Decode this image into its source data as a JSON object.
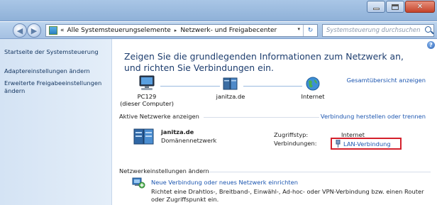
{
  "window": {
    "buttons": {
      "minimize": "",
      "maximize": "",
      "close": "✕"
    },
    "colors": {
      "titlebar": "#a9c6e6",
      "link": "#1c56b0",
      "highlight_box": "#d4202c"
    }
  },
  "address_bar": {
    "prefix": "«",
    "crumbs": [
      "Alle Systemsteuerungselemente",
      "Netzwerk- und Freigabecenter"
    ],
    "separator": "▸",
    "dropdown": "▾",
    "refresh": "↻",
    "search_placeholder": "Systemsteuerung durchsuchen"
  },
  "nav": {
    "back": "◀",
    "forward": "▶"
  },
  "sidebar": {
    "items": [
      {
        "label": "Startseite der Systemsteuerung"
      },
      {
        "label": "Adaptereinstellungen ändern"
      },
      {
        "label": "Erweiterte Freigabeeinstellungen ändern"
      }
    ]
  },
  "main": {
    "help": "?",
    "headline": "Zeigen Sie die grundlegenden Informationen zum Netzwerk an, und richten Sie Verbindungen ein.",
    "overview_link": "Gesamtübersicht anzeigen",
    "map": {
      "pc_name": "PC129",
      "pc_sub": "(dieser Computer)",
      "network": "janitza.de",
      "internet": "Internet"
    },
    "active_networks": {
      "header": "Aktive Netzwerke anzeigen",
      "connect_link": "Verbindung herstellen oder trennen",
      "name": "janitza.de",
      "type": "Domänennetzwerk",
      "access_label": "Zugriffstyp:",
      "access_value": "Internet",
      "connections_label": "Verbindungen:",
      "connections_value": "LAN-Verbindung"
    },
    "settings": {
      "header": "Netzwerkeinstellungen ändern",
      "new_link": "Neue Verbindung oder neues Netzwerk einrichten",
      "new_desc": "Richtet eine Drahtlos-, Breitband-, Einwähl-, Ad-hoc- oder VPN-Verbindung bzw. einen Router oder Zugriffspunkt ein."
    }
  }
}
